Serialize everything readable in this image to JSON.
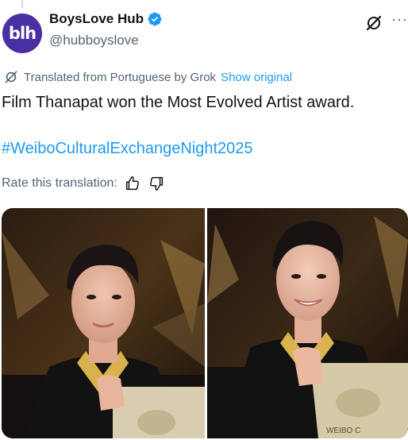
{
  "author": {
    "display_name": "BoysLove Hub",
    "handle": "@hubboyslove",
    "avatar_text": "blh",
    "verified_icon": "verified-badge-icon"
  },
  "header_icons": [
    "grok-icon",
    "more-icon"
  ],
  "translation": {
    "notice": "Translated from Portuguese by Grok",
    "show_original": "Show original"
  },
  "tweet": {
    "text": "Film Thanapat won the Most Evolved Artist award.",
    "hashtag": "#WeiboCulturalExchangeNight2025"
  },
  "rate": {
    "label": "Rate this translation:"
  },
  "media": {
    "plaque_text": "WEIBO C"
  },
  "colors": {
    "accent": "#1d9bf0",
    "secondary_text": "#536471",
    "avatar_bg": "#4a2fa3"
  }
}
